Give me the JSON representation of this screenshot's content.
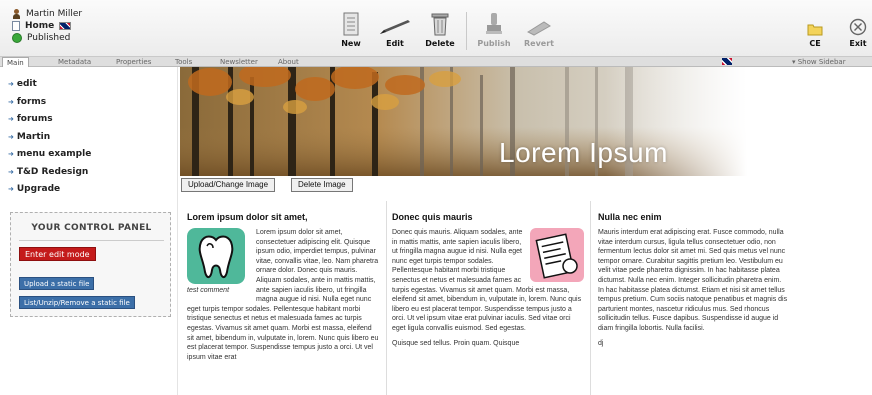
{
  "user": {
    "name": "Martin Miller",
    "page": "Home",
    "status": "Published"
  },
  "toolbar": {
    "new": "New",
    "edit": "Edit",
    "delete": "Delete",
    "publish": "Publish",
    "revert": "Revert",
    "ce": "CE",
    "exit": "Exit"
  },
  "tabs": [
    "Main",
    "Metadata",
    "Properties",
    "Tools",
    "Newsletter",
    "About"
  ],
  "tab_right": "▾ Show Sidebar",
  "sidebar": {
    "items": [
      "edit",
      "forms",
      "forums",
      "Martin",
      "menu example",
      "T&D Redesign",
      "Upgrade"
    ],
    "panel_title": "YOUR CONTROL PANEL",
    "edit_mode": "Enter edit mode",
    "upload_static": "Upload a static file",
    "list_static": "List/Unzip/Remove a static file"
  },
  "banner": {
    "text": "Lorem Ipsum"
  },
  "image_buttons": {
    "upload": "Upload/Change Image",
    "delete": "Delete Image"
  },
  "columns": [
    {
      "title": "Lorem ipsum dolor sit amet,",
      "caption": "test comment",
      "paragraphs": [
        "Lorem ipsum dolor sit amet, consectetuer adipiscing elit. Quisque ipsum odio, imperdiet tempus, pulvinar vitae, convallis vitae, leo. Nam pharetra ornare dolor. Donec quis mauris. Aliquam sodales, ante in mattis mattis, ante sapien iaculis libero, ut fringilla magna augue id nisi. Nulla eget nunc eget turpis tempor sodales. Pellentesque habitant morbi tristique senectus et netus et malesuada fames ac turpis egestas. Vivamus sit amet quam. Morbi est massa, eleifend sit amet, bibendum in, vulputate in, lorem. Nunc quis libero eu est placerat tempor. Suspendisse tempus justo a orci. Ut vel ipsum vitae erat"
      ]
    },
    {
      "title": "Donec quis mauris",
      "paragraphs": [
        "Donec quis mauris. Aliquam sodales, ante in mattis mattis, ante sapien iaculis libero, ut fringilla magna augue id nisi. Nulla eget nunc eget turpis tempor sodales. Pellentesque habitant morbi tristique senectus et netus et malesuada fames ac turpis egestas. Vivamus sit amet quam. Morbi est massa, eleifend sit amet, bibendum in, vulputate in, lorem. Nunc quis libero eu est placerat tempor. Suspendisse tempus justo a orci. Ut vel ipsum vitae erat pulvinar iaculis. Sed vitae orci eget ligula convallis euismod. Sed egestas.",
        "Quisque sed tellus. Proin quam. Quisque"
      ]
    },
    {
      "title": "Nulla nec enim",
      "paragraphs": [
        "Mauris interdum erat adipiscing erat. Fusce commodo, nulla vitae interdum cursus, ligula tellus consectetuer odio, non fermentum lectus dolor sit amet mi. Sed quis metus vel nunc tempor ornare. Curabitur sagittis pretium leo. Vestibulum eu velit vitae pede pharetra dignissim. In hac habitasse platea dictumst. Nulla nec enim. Integer sollicitudin pharetra enim. In hac habitasse platea dictumst. Etiam et nisi sit amet tellus tempus pretium. Cum sociis natoque penatibus et magnis dis parturient montes, nascetur ridiculus mus. Sed rhoncus sollicitudin tellus. Fusce dapibus. Suspendisse id augue id diam fringilla lobortis. Nulla facilisi.",
        "dj"
      ]
    }
  ]
}
